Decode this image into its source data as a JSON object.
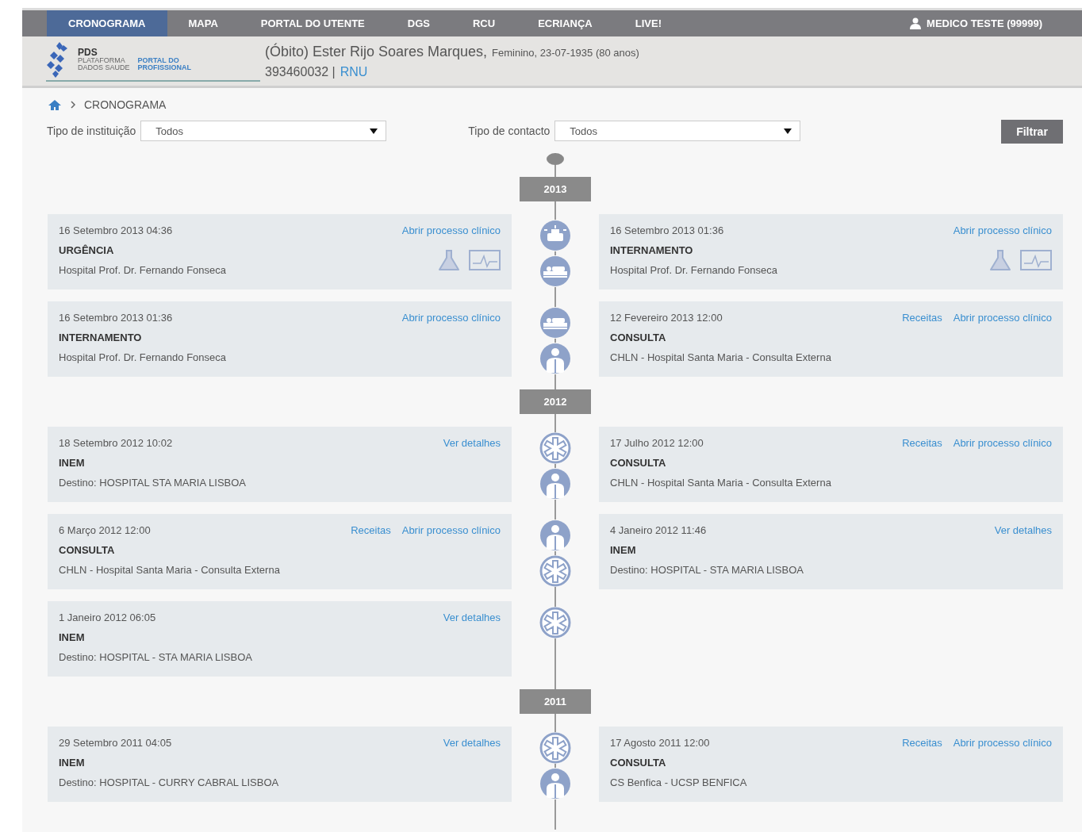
{
  "nav": {
    "tabs": [
      {
        "label": "CRONOGRAMA",
        "selected": true
      },
      {
        "label": "MAPA",
        "selected": false
      },
      {
        "label": "PORTAL DO UTENTE",
        "selected": false
      },
      {
        "label": "DGS",
        "selected": false
      },
      {
        "label": "RCU",
        "selected": false
      },
      {
        "label": "ECRIANÇA",
        "selected": false
      },
      {
        "label": "LIVE!",
        "selected": false
      }
    ],
    "user": "MEDICO TESTE (99999)"
  },
  "logo": {
    "title": "PDS",
    "subtitle": [
      "PLATAFORMA",
      "DADOS SAUDE"
    ],
    "portal": [
      "PORTAL DO",
      "PROFISSIONAL"
    ]
  },
  "patient": {
    "name": "(Óbito) Ester Rijo Soares Marques,",
    "details": "Feminino, 23-07-1935 (80 anos)",
    "number": "393460032 |",
    "link": "RNU"
  },
  "breadcrumb": [
    "CRONOGRAMA"
  ],
  "filters": [
    {
      "label": "Tipo de instituição",
      "value": "Todos"
    },
    {
      "label": "Tipo de contacto",
      "value": "Todos"
    }
  ],
  "filter_button": "Filtrar",
  "years": [
    {
      "year": "2013",
      "rows": [
        {
          "left": {
            "kind": "urgencia",
            "date": "16 Setembro 2013 04:36",
            "type": "URGÊNCIA",
            "place": "Hospital Prof. Dr. Fernando Fonseca",
            "links": [
              "Abrir processo clínico"
            ],
            "attachments": true
          },
          "right": {
            "kind": "internamento",
            "date": "16 Setembro 2013 01:36",
            "type": "INTERNAMENTO",
            "place": "Hospital Prof. Dr. Fernando Fonseca",
            "links": [
              "Abrir processo clínico"
            ],
            "attachments": true
          }
        },
        {
          "left": {
            "kind": "internamento",
            "date": "16 Setembro 2013 01:36",
            "type": "INTERNAMENTO",
            "place": "Hospital Prof. Dr. Fernando Fonseca",
            "links": [
              "Abrir processo clínico"
            ],
            "attachments": false
          },
          "right": {
            "kind": "consulta",
            "date": "12 Fevereiro 2013 12:00",
            "type": "CONSULTA",
            "place": "CHLN - Hospital Santa Maria - Consulta Externa",
            "links": [
              "Receitas",
              "Abrir processo clínico"
            ],
            "attachments": false
          }
        }
      ]
    },
    {
      "year": "2012",
      "rows": [
        {
          "left": {
            "kind": "inem",
            "date": "18 Setembro 2012 10:02",
            "type": "INEM",
            "place": "Destino: HOSPITAL STA MARIA LISBOA",
            "links": [
              "Ver detalhes"
            ],
            "attachments": false
          },
          "right": {
            "kind": "consulta",
            "date": "17 Julho 2012 12:00",
            "type": "CONSULTA",
            "place": "CHLN - Hospital Santa Maria - Consulta Externa",
            "links": [
              "Receitas",
              "Abrir processo clínico"
            ],
            "attachments": false
          }
        },
        {
          "left": {
            "kind": "consulta",
            "date": "6 Março 2012 12:00",
            "type": "CONSULTA",
            "place": "CHLN - Hospital Santa Maria - Consulta Externa",
            "links": [
              "Receitas",
              "Abrir processo clínico"
            ],
            "attachments": false
          },
          "right": {
            "kind": "inem",
            "date": "4 Janeiro 2012 11:46",
            "type": "INEM",
            "place": "Destino: HOSPITAL - STA MARIA LISBOA",
            "links": [
              "Ver detalhes"
            ],
            "attachments": false
          }
        },
        {
          "left": {
            "kind": "inem",
            "date": "1 Janeiro 2012 06:05",
            "type": "INEM",
            "place": "Destino: HOSPITAL - STA MARIA LISBOA",
            "links": [
              "Ver detalhes"
            ],
            "attachments": false
          }
        }
      ]
    },
    {
      "year": "2011",
      "rows": [
        {
          "left": {
            "kind": "inem",
            "date": "29 Setembro 2011 04:05",
            "type": "INEM",
            "place": "Destino: HOSPITAL - CURRY CABRAL LISBOA",
            "links": [
              "Ver detalhes"
            ],
            "attachments": false
          },
          "right": {
            "kind": "consulta",
            "date": "17 Agosto 2011 12:00",
            "type": "CONSULTA",
            "place": "CS Benfica - UCSP BENFICA",
            "links": [
              "Receitas",
              "Abrir processo clínico"
            ],
            "attachments": false
          }
        }
      ]
    }
  ]
}
